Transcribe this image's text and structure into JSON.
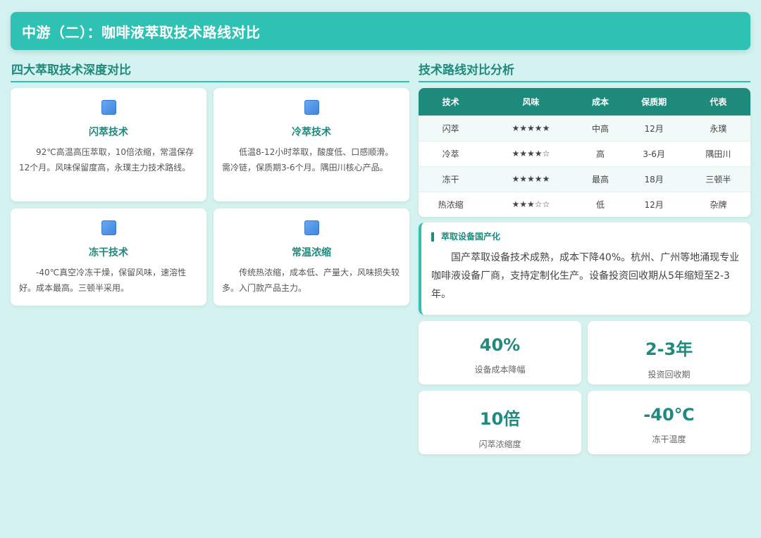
{
  "header": {
    "title": "中游（二）：咖啡液萃取技术路线对比"
  },
  "left": {
    "section_title": "四大萃取技术深度对比",
    "cards": [
      {
        "icon": "blue-square-icon",
        "name": "闪萃技术",
        "desc": "92℃高温高压萃取，10倍浓缩，常温保存12个月。风味保留度高，永璞主力技术路线。"
      },
      {
        "icon": "blue-square-icon",
        "name": "冷萃技术",
        "desc": "低温8-12小时萃取，酸度低、口感顺滑。需冷链，保质期3-6个月。隅田川核心产品。"
      },
      {
        "icon": "blue-square-icon",
        "name": "冻干技术",
        "desc": "-40℃真空冷冻干燥，保留风味，速溶性好。成本最高。三顿半采用。"
      },
      {
        "icon": "blue-square-icon",
        "name": "常温浓缩",
        "desc": "传统热浓缩，成本低、产量大，风味损失较多。入门款产品主力。"
      }
    ]
  },
  "right": {
    "section_title": "技术路线对比分析",
    "table": {
      "headers": [
        "技术",
        "风味",
        "成本",
        "保质期",
        "代表"
      ],
      "rows": [
        [
          "闪萃",
          "★★★★★",
          "中高",
          "12月",
          "永璞"
        ],
        [
          "冷萃",
          "★★★★☆",
          "高",
          "3-6月",
          "隅田川"
        ],
        [
          "冻干",
          "★★★★★",
          "最高",
          "18月",
          "三顿半"
        ],
        [
          "热浓缩",
          "★★★☆☆",
          "低",
          "12月",
          "杂牌"
        ]
      ]
    },
    "note": {
      "title": "萃取设备国产化",
      "body": "国产萃取设备技术成熟，成本下降40%。杭州、广州等地涌现专业咖啡液设备厂商，支持定制化生产。设备投资回收期从5年缩短至2-3年。"
    },
    "stats": [
      {
        "value": "40%",
        "label": "设备成本降幅"
      },
      {
        "value": "2-3年",
        "label": "投资回收期"
      },
      {
        "value": "10倍",
        "label": "闪萃浓缩度"
      },
      {
        "value": "-40℃",
        "label": "冻干温度"
      }
    ]
  },
  "colors": {
    "accent": "#2fc1b4",
    "dark_accent": "#1e8a7c",
    "background": "#d4f2ef",
    "icon_blue": "#4a90e2"
  }
}
